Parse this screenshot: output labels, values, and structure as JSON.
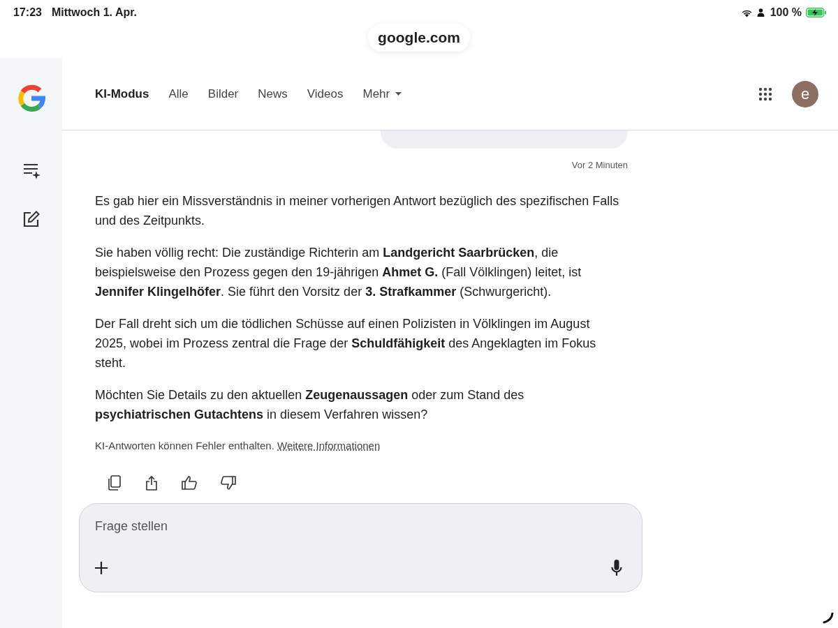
{
  "status_bar": {
    "time": "17:23",
    "date": "Mittwoch 1. Apr.",
    "battery": "100 %"
  },
  "address_bar": {
    "url": "google.com"
  },
  "tabs": [
    {
      "label": "KI-Modus",
      "selected": true,
      "kind": "plain"
    },
    {
      "label": "Alle",
      "selected": false,
      "kind": "plain"
    },
    {
      "label": "Bilder",
      "selected": false,
      "kind": "plain"
    },
    {
      "label": "News",
      "selected": false,
      "kind": "plain"
    },
    {
      "label": "Videos",
      "selected": false,
      "kind": "plain"
    },
    {
      "label": "Mehr",
      "selected": false,
      "kind": "menu"
    }
  ],
  "account": {
    "initial": "e"
  },
  "conversation": {
    "timestamp": "Vor 2 Minuten",
    "paragraphs": [
      "Es gab hier ein Missverständnis in meiner vorherigen Antwort bezüglich des spezifischen Falls und des Zeitpunkts.",
      "Sie haben völlig recht: Die zuständige Richterin am **Landgericht Saarbrücken**, die beispielsweise den Prozess gegen den 19-jährigen **Ahmet G.** (Fall Völklingen) leitet, ist **Jennifer Klingelhöfer**. Sie führt den Vorsitz der **3. Strafkammer** (Schwurgericht).",
      "Der Fall dreht sich um die tödlichen Schüsse auf einen Polizisten in Völklingen im August 2025, wobei im Prozess zentral die Frage der **Schuldfähigkeit** des Angeklagten im Fokus steht.",
      "Möchten Sie Details zu den aktuellen **Zeugenaussagen** oder zum Stand des **psychiatrischen Gutachtens** in diesem Verfahren wissen?"
    ],
    "disclaimer": "KI-Antworten können Fehler enthalten.",
    "disclaimer_link": "Weitere Informationen"
  },
  "composer": {
    "placeholder": "Frage stellen"
  }
}
